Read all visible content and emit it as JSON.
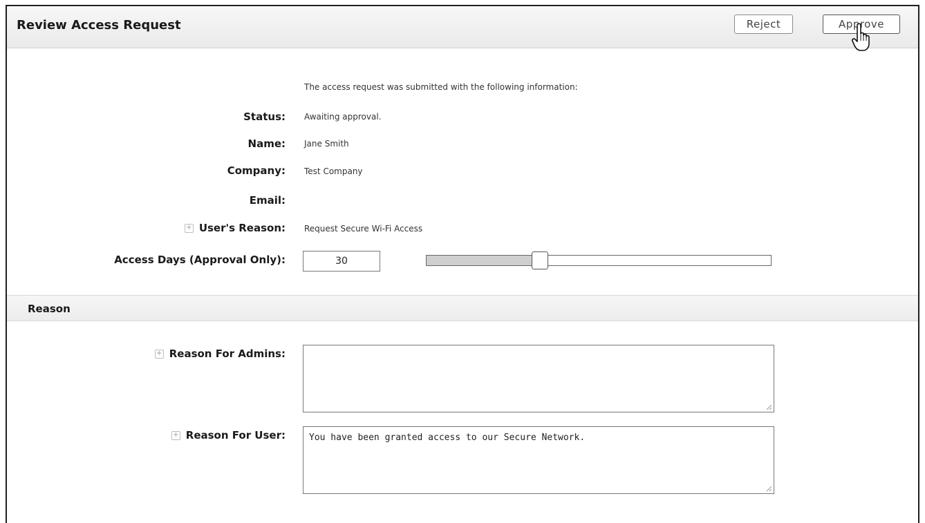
{
  "header": {
    "title": "Review Access Request",
    "reject_label": "Reject",
    "approve_label": "Approve"
  },
  "info": {
    "intro": "The access request was submitted with the following information:",
    "status_label": "Status:",
    "status_value": "Awaiting approval.",
    "name_label": "Name:",
    "name_value": "Jane Smith",
    "company_label": "Company:",
    "company_value": "Test Company",
    "email_label": "Email:",
    "email_value": "",
    "reason_label": "User's Reason:",
    "reason_value": "Request Secure Wi-Fi Access",
    "access_days_label": "Access Days (Approval Only):",
    "access_days_value": "30",
    "access_days_slider_fraction": 0.33
  },
  "reason_section": {
    "title": "Reason",
    "admins_label": "Reason For Admins:",
    "admins_value": "",
    "user_label": "Reason For User:",
    "user_value": "You have been granted access to our Secure Network."
  },
  "icons": {
    "expand": "plus-icon",
    "cursor": "hand-pointer-icon",
    "resize": "resize-grip-icon"
  }
}
